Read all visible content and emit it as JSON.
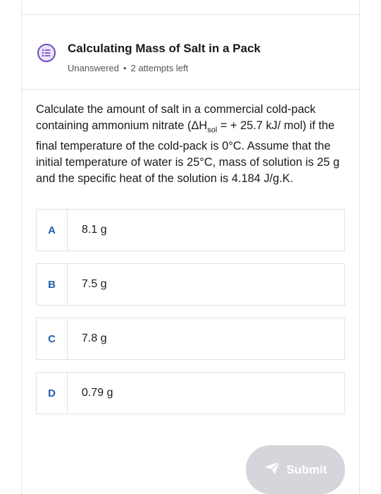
{
  "question_card": {
    "title": "Calculating Mass of Salt in a Pack",
    "status": "Unanswered",
    "separator": "•",
    "attempts": "2 attempts left",
    "icon": "question-list-icon",
    "accent_color": "#6d4bc0"
  },
  "question": {
    "text_part1": "Calculate the amount of salt in a commercial cold-pack containing ammonium nitrate (ΔH",
    "subscript": "sol",
    "text_part2": " = + 25.7 kJ/ mol) if the final temperature of the cold-pack is 0°C. Assume that the initial temperature of water is 25°C, mass of solution is 25 g and the specific heat of the solution is 4.184 J/g.K."
  },
  "options": [
    {
      "letter": "A",
      "value": "8.1 g"
    },
    {
      "letter": "B",
      "value": "7.5 g"
    },
    {
      "letter": "C",
      "value": "7.8 g"
    },
    {
      "letter": "D",
      "value": "0.79 g"
    }
  ],
  "submit": {
    "label": "Submit",
    "icon": "send-icon",
    "enabled": false
  }
}
